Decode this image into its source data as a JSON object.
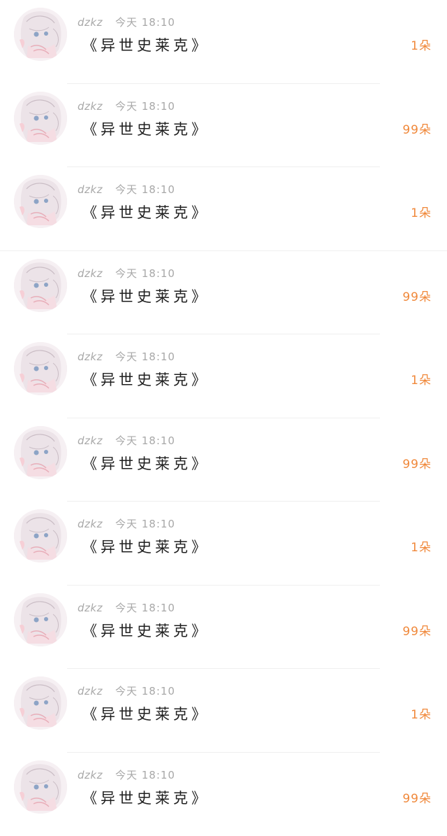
{
  "rows": [
    {
      "username": "dzkz",
      "time": "今天 18:10",
      "gift": "《异世史莱克》",
      "count": "1朵"
    },
    {
      "username": "dzkz",
      "time": "今天 18:10",
      "gift": "《异世史莱克》",
      "count": "99朵"
    },
    {
      "username": "dzkz",
      "time": "今天 18:10",
      "gift": "《异世史莱克》",
      "count": "1朵"
    },
    {
      "username": "dzkz",
      "time": "今天 18:10",
      "gift": "《异世史莱克》",
      "count": "99朵"
    },
    {
      "username": "dzkz",
      "time": "今天 18:10",
      "gift": "《异世史莱克》",
      "count": "1朵"
    },
    {
      "username": "dzkz",
      "time": "今天 18:10",
      "gift": "《异世史莱克》",
      "count": "99朵"
    },
    {
      "username": "dzkz",
      "time": "今天 18:10",
      "gift": "《异世史莱克》",
      "count": "1朵"
    },
    {
      "username": "dzkz",
      "time": "今天 18:10",
      "gift": "《异世史莱克》",
      "count": "99朵"
    },
    {
      "username": "dzkz",
      "time": "今天 18:10",
      "gift": "《异世史莱克》",
      "count": "1朵"
    },
    {
      "username": "dzkz",
      "time": "今天 18:10",
      "gift": "《异世史莱克》",
      "count": "99朵"
    }
  ],
  "colors": {
    "username": "#a8a8a8",
    "time": "#a8a8a8",
    "gift_text": "#1f1f1f",
    "count": "#f0883a",
    "divider": "#efefef"
  },
  "icons": {
    "avatar": "anime-girl-avatar-icon"
  }
}
